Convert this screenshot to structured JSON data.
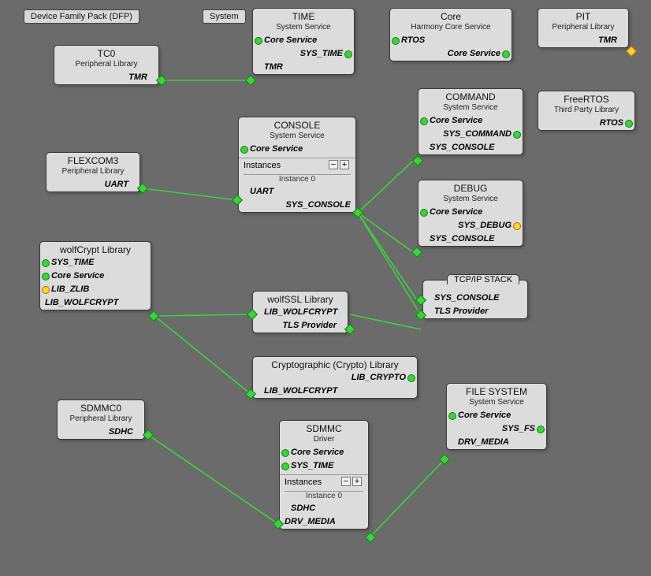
{
  "tags": {
    "dfp": "Device Family Pack (DFP)",
    "system": "System"
  },
  "labels": {
    "instances": "Instances",
    "instance0": "Instance 0",
    "minus": "−",
    "plus": "+"
  },
  "nodes": {
    "tc0": {
      "title": "TC0",
      "subtitle": "Peripheral Library",
      "row1": "TMR"
    },
    "time": {
      "title": "TIME",
      "subtitle": "System Service",
      "r1": "Core Service",
      "r2": "SYS_TIME",
      "r3": "TMR"
    },
    "core": {
      "title": "Core",
      "subtitle": "Harmony Core Service",
      "r1": "RTOS",
      "r2": "Core Service"
    },
    "pit": {
      "title": "PIT",
      "subtitle": "Peripheral Library",
      "r1": "TMR"
    },
    "freertos": {
      "title": "FreeRTOS",
      "subtitle": "Third Party Library",
      "r1": "RTOS"
    },
    "flexcom": {
      "title": "FLEXCOM3",
      "subtitle": "Peripheral Library",
      "r1": "UART"
    },
    "console": {
      "title": "CONSOLE",
      "subtitle": "System Service",
      "r1": "Core Service",
      "inst_r1": "UART",
      "inst_r2": "SYS_CONSOLE"
    },
    "command": {
      "title": "COMMAND",
      "subtitle": "System Service",
      "r1": "Core Service",
      "r2": "SYS_COMMAND",
      "r3": "SYS_CONSOLE"
    },
    "debug": {
      "title": "DEBUG",
      "subtitle": "System Service",
      "r1": "Core Service",
      "r2": "SYS_DEBUG",
      "r3": "SYS_CONSOLE"
    },
    "wolfcrypt": {
      "title": "wolfCrypt Library",
      "r1": "SYS_TIME",
      "r2": "Core Service",
      "r3": "LIB_ZLIB",
      "r4": "LIB_WOLFCRYPT"
    },
    "wolfssl": {
      "title": "wolfSSL Library",
      "r1": "LIB_WOLFCRYPT",
      "r2": "TLS Provider"
    },
    "tcpip": {
      "title": "TCP/IP STACK",
      "r1": "SYS_CONSOLE",
      "r2": "TLS Provider"
    },
    "crypto": {
      "title": "Cryptographic (Crypto) Library",
      "r1": "LIB_CRYPTO",
      "r2": "LIB_WOLFCRYPT"
    },
    "sdmmc0": {
      "title": "SDMMC0",
      "subtitle": "Peripheral Library",
      "r1": "SDHC"
    },
    "sdmmc": {
      "title": "SDMMC",
      "subtitle": "Driver",
      "r1": "Core Service",
      "r2": "SYS_TIME",
      "inst_r1": "SDHC",
      "inst_r2": "DRV_MEDIA"
    },
    "filesys": {
      "title": "FILE SYSTEM",
      "subtitle": "System Service",
      "r1": "Core Service",
      "r2": "SYS_FS",
      "r3": "DRV_MEDIA"
    }
  }
}
